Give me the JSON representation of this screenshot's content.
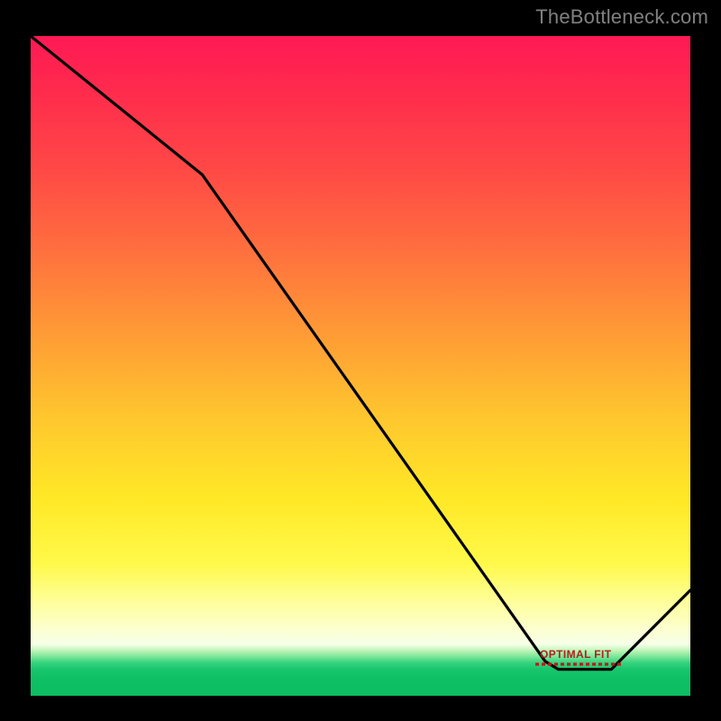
{
  "watermark": "TheBottleneck.com",
  "marker": {
    "label": "OPTIMAL FIT"
  },
  "chart_data": {
    "type": "line",
    "title": "",
    "xlabel": "",
    "ylabel": "",
    "xlim": [
      0,
      100
    ],
    "ylim": [
      0,
      100
    ],
    "series": [
      {
        "name": "curve",
        "x": [
          0,
          26,
          78,
          80,
          88,
          100
        ],
        "values": [
          100,
          79,
          5.2,
          4,
          4,
          16
        ]
      }
    ],
    "annotations": [
      {
        "text": "OPTIMAL FIT",
        "x": 84,
        "y": 4
      }
    ],
    "background": "red-yellow-green vertical heat gradient"
  }
}
